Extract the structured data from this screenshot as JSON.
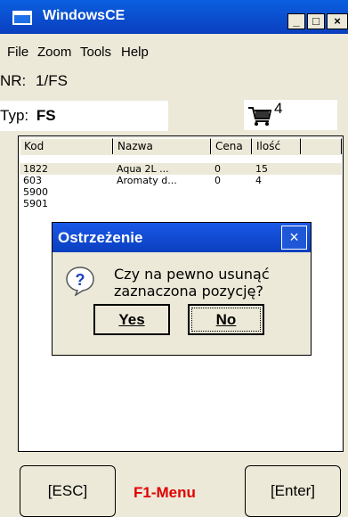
{
  "window": {
    "title": "WindowsCE",
    "minimize": "_",
    "maximize": "□",
    "close": "×"
  },
  "menu": [
    "File",
    "Zoom",
    "Tools",
    "Help"
  ],
  "nr": {
    "label": "NR:",
    "value": "1/FS"
  },
  "typ": {
    "label": "Typ:",
    "value": "FS"
  },
  "cart": {
    "count": "4"
  },
  "table": {
    "headers": [
      "Kod",
      "Nazwa",
      "Cena",
      "Ilość"
    ],
    "rows": [
      [
        "1822",
        "Aqua 2L ...",
        "0",
        "15"
      ],
      [
        "603",
        "Aromaty d...",
        "0",
        "4"
      ],
      [
        "5900",
        "",
        "",
        ""
      ],
      [
        "5901",
        "",
        "",
        ""
      ]
    ]
  },
  "dialog": {
    "title": "Ostrzeżenie",
    "message_line1": "Czy na pewno usunąć",
    "message_line2": "zaznaczona pozycję?",
    "yes_label": "Yes",
    "no_label": "No",
    "close": "×",
    "icon": "question-icon"
  },
  "bottom": {
    "esc_label": "[ESC]",
    "menu_label": "F1-Menu",
    "enter_label": "[Enter]"
  },
  "colors": {
    "title_bar": "#0a3fbf",
    "menu_text": "#e00000",
    "background": "#ece9d8"
  }
}
